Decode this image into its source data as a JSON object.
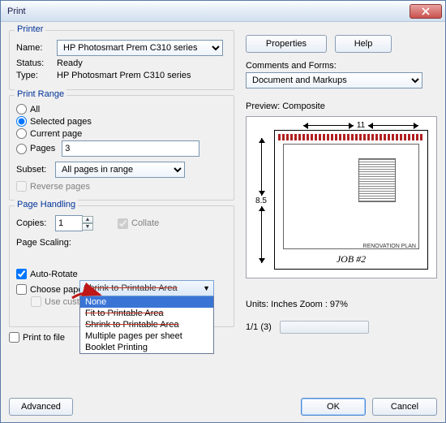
{
  "window": {
    "title": "Print"
  },
  "printer": {
    "legend": "Printer",
    "name_label": "Name:",
    "name_value": "HP Photosmart Prem C310 series",
    "status_label": "Status:",
    "status_value": "Ready",
    "type_label": "Type:",
    "type_value": "HP Photosmart Prem C310 series",
    "properties_btn": "Properties",
    "help_btn": "Help",
    "comments_label": "Comments and Forms:",
    "comments_value": "Document and Markups"
  },
  "range": {
    "legend": "Print Range",
    "all": "All",
    "selected": "Selected pages",
    "current": "Current page",
    "pages": "Pages",
    "pages_value": "3",
    "subset_label": "Subset:",
    "subset_value": "All pages in range",
    "reverse": "Reverse pages"
  },
  "handling": {
    "legend": "Page Handling",
    "copies_label": "Copies:",
    "copies_value": "1",
    "collate": "Collate",
    "scaling_label": "Page Scaling:",
    "scaling_selected": "Shrink to Printable Area",
    "options": {
      "none": "None",
      "fit": "Fit to Printable Area",
      "shrink": "Shrink to Printable Area",
      "multi": "Multiple pages per sheet",
      "booklet": "Booklet Printing"
    },
    "auto_rotate": "Auto-Rotate",
    "choose_paper": "Choose pape",
    "custom": "Use custom paper size when needed"
  },
  "preview": {
    "label": "Preview: Composite",
    "width": "11",
    "height": "8.5",
    "job": "JOB #2",
    "sub": "RENOVATION PLAN",
    "units": "Units: Inches  Zoom :   97%",
    "page": "1/1 (3)"
  },
  "footer": {
    "print_to_file": "Print to file",
    "advanced": "Advanced",
    "ok": "OK",
    "cancel": "Cancel"
  }
}
